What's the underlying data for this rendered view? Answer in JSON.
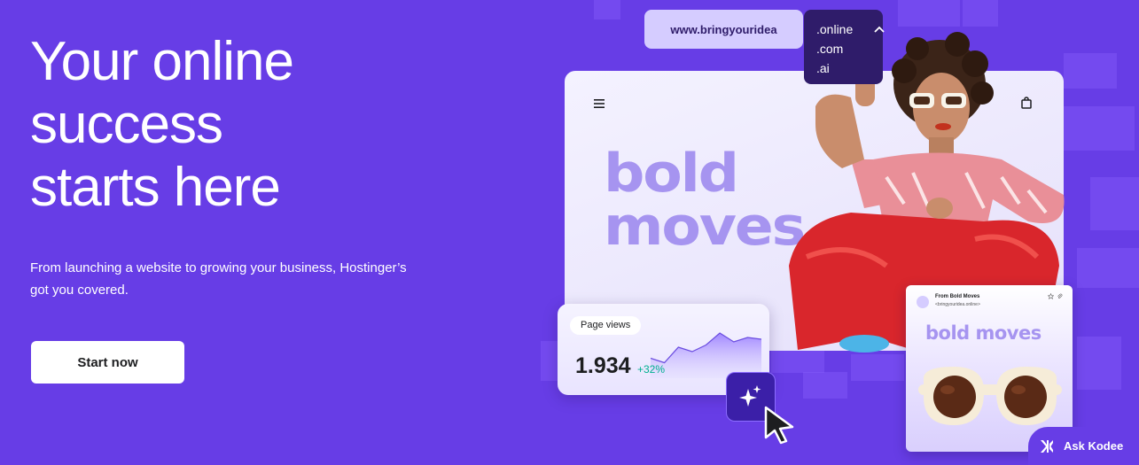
{
  "hero": {
    "title_lines": [
      "Your online",
      "success",
      "starts here"
    ],
    "subtitle_line1": "From launching a website to growing your business, Hostinger’s",
    "subtitle_line2": "got you covered.",
    "cta_label": "Start now"
  },
  "domain_search": {
    "domain": "www.bringyouridea",
    "tld_options": [
      ".online",
      ".com",
      ".ai"
    ]
  },
  "website_preview": {
    "heading_line1": "bold",
    "heading_line2": "moves"
  },
  "page_views_card": {
    "label": "Page views",
    "value": "1.934",
    "change": "+32%",
    "trend": [
      0.25,
      0.15,
      0.5,
      0.4,
      0.55,
      0.82,
      0.62,
      0.72,
      0.68
    ]
  },
  "email_card": {
    "from": "From Bold Moves",
    "address": "<bringyouridea.online>",
    "heading": "bold moves"
  },
  "assistant": {
    "label": "Ask Kodee"
  },
  "colors": {
    "brand": "#673de6",
    "dark_purple": "#2f1c6a",
    "light_purple": "#d5ccff",
    "accent_text": "#a694f0",
    "positive": "#00b090"
  }
}
